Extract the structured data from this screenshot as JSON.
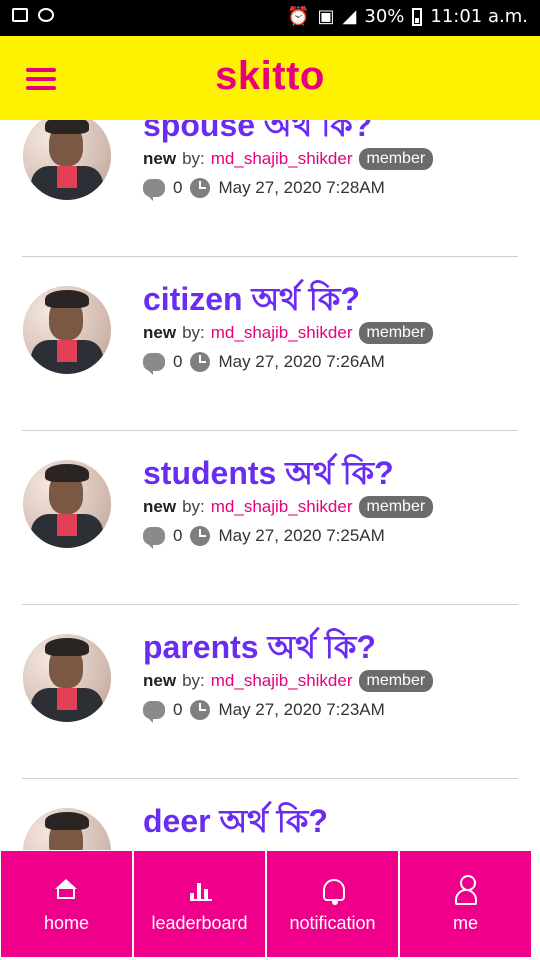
{
  "status_bar": {
    "battery": "30%",
    "time": "11:01 a.m."
  },
  "header": {
    "app_name": "skitto",
    "colors": {
      "header_bg": "#fff200",
      "accent": "#e6007e"
    }
  },
  "posts": [
    {
      "title": "spouse অর্থ কি?",
      "status": "new",
      "by_label": "by:",
      "username": "md_shajib_shikder",
      "role": "member",
      "comments": "0",
      "date": "May 27, 2020 7:28AM"
    },
    {
      "title": "citizen অর্থ কি?",
      "status": "new",
      "by_label": "by:",
      "username": "md_shajib_shikder",
      "role": "member",
      "comments": "0",
      "date": "May 27, 2020 7:26AM"
    },
    {
      "title": "students অর্থ কি?",
      "status": "new",
      "by_label": "by:",
      "username": "md_shajib_shikder",
      "role": "member",
      "comments": "0",
      "date": "May 27, 2020 7:25AM"
    },
    {
      "title": "parents অর্থ কি?",
      "status": "new",
      "by_label": "by:",
      "username": "md_shajib_shikder",
      "role": "member",
      "comments": "0",
      "date": "May 27, 2020 7:23AM"
    },
    {
      "title": "deer অর্থ কি?"
    }
  ],
  "bottom_nav": [
    {
      "label": "home",
      "icon": "home-icon"
    },
    {
      "label": "leaderboard",
      "icon": "leaderboard-icon"
    },
    {
      "label": "notification",
      "icon": "bell-icon"
    },
    {
      "label": "me",
      "icon": "user-icon"
    }
  ]
}
